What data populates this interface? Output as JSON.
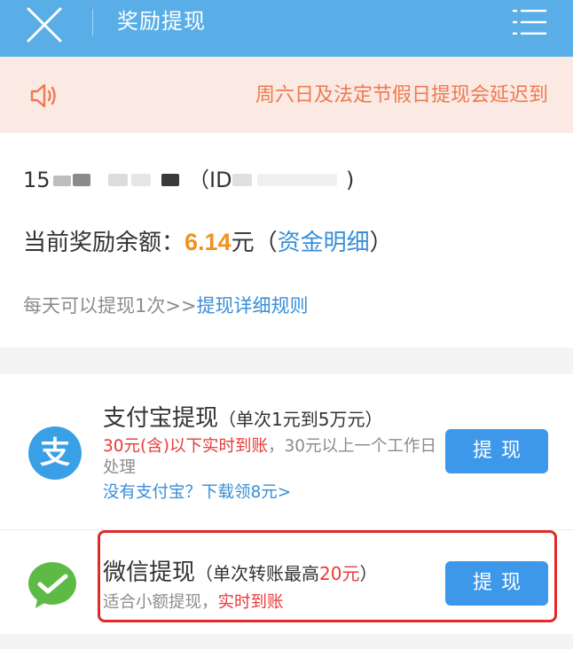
{
  "header": {
    "close_icon": "close-icon",
    "title": "奖励提现",
    "menu_icon": "list-menu-icon"
  },
  "notice": {
    "icon": "speaker-icon",
    "text": "周六日及法定节假日提现会延迟到"
  },
  "account": {
    "prefix": "15",
    "mid": "（ID",
    "suffix": ")"
  },
  "balance": {
    "label": "当前奖励余额：",
    "amount": "6.14",
    "unit": "元（",
    "link": "资金明细",
    "close": "）"
  },
  "rules": {
    "text": "每天可以提现1次>>",
    "link": "提现详细规则"
  },
  "options": [
    {
      "icon": "alipay-icon",
      "logo_text": "支",
      "title": "支付宝提现",
      "title_note": "（单次1元到5万元）",
      "realtime": "30元(含)以下实时到账",
      "rest": "，30元以上一个工作日处理",
      "link": "没有支付宝？下载领8元>",
      "button": "提现"
    },
    {
      "icon": "wechat-icon",
      "title": "微信提现",
      "title_note_pre": "（单次转账最高",
      "title_note_red": "20元",
      "title_note_post": "）",
      "desc_gray": "适合小额提现，",
      "desc_red": "实时到账",
      "button": "提现"
    }
  ],
  "colors": {
    "header": "#59aee8",
    "notice_bg": "#fbe9e3",
    "notice_text": "#ee7a51",
    "amount": "#f0921e",
    "link": "#3a8ed8",
    "button": "#3e98ea",
    "red": "#e83a3a",
    "highlight": "#e02a2a",
    "alipay": "#3aa0e6",
    "wechat": "#5dbb45"
  }
}
